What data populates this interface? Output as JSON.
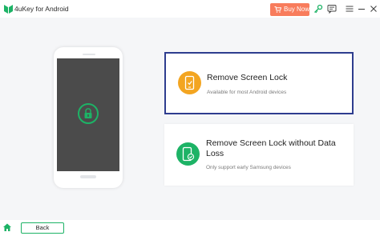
{
  "app": {
    "title": "4uKey for Android",
    "accent_color": "#1db366",
    "brand_color": "#2e3d8f"
  },
  "titlebar": {
    "buy_now_label": "Buy Now",
    "buy_now_color": "#f87c5c",
    "icons": [
      "logo-icon",
      "cart-icon",
      "key-icon",
      "feedback-icon",
      "menu-icon",
      "minimize-icon",
      "close-icon"
    ]
  },
  "options": [
    {
      "title": "Remove Screen Lock",
      "subtitle": "Available for most Android devices",
      "icon": "phone-unlock-icon",
      "icon_color": "#f3a521",
      "selected": true
    },
    {
      "title": "Remove Screen Lock without Data Loss",
      "subtitle": "Only support early Samsung devices",
      "icon": "phone-check-icon",
      "icon_color": "#1db366",
      "selected": false
    }
  ],
  "phone": {
    "lock_icon": "lock-icon"
  },
  "footer": {
    "back_label": "Back",
    "home_icon": "home-icon"
  }
}
